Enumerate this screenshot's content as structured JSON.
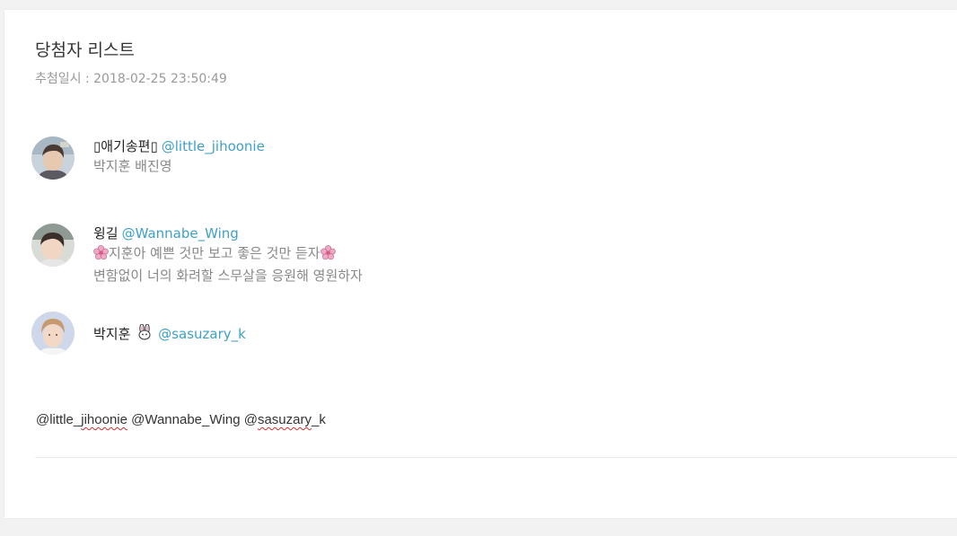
{
  "header": {
    "title": "당첨자 리스트",
    "draw_date": "추첨일시 : 2018-02-25 23:50:49"
  },
  "winners": [
    {
      "name": "애기송편",
      "name_prefix_glyph": "▯",
      "name_suffix_glyph": "▯",
      "handle": "@little_jihoonie",
      "message_lines": [
        "박지훈 배진영"
      ]
    },
    {
      "name": "윙길",
      "handle": "@Wannabe_Wing",
      "message_lines": [
        "지훈아 예쁜 것만 보고 좋은 것만 듣자",
        "변함없이 너의 화려할 스무살을 응원해 영원하자"
      ],
      "message_emoji": "cherry-blossom-icon"
    },
    {
      "name": "박지훈",
      "name_emoji": "rabbit-icon",
      "handle": "@sasuzary_k",
      "message_lines": []
    }
  ],
  "mentions": {
    "m1_prefix": "@little_",
    "m1_word": "jihoonie",
    "m2": "@Wannabe_Wing",
    "m3_prefix": "@",
    "m3_word": "sasuzary",
    "m3_suffix": "_k"
  },
  "colors": {
    "handle": "#3ea0c8",
    "muted_text": "#888888",
    "spellcheck_underline": "#d32f2f"
  }
}
